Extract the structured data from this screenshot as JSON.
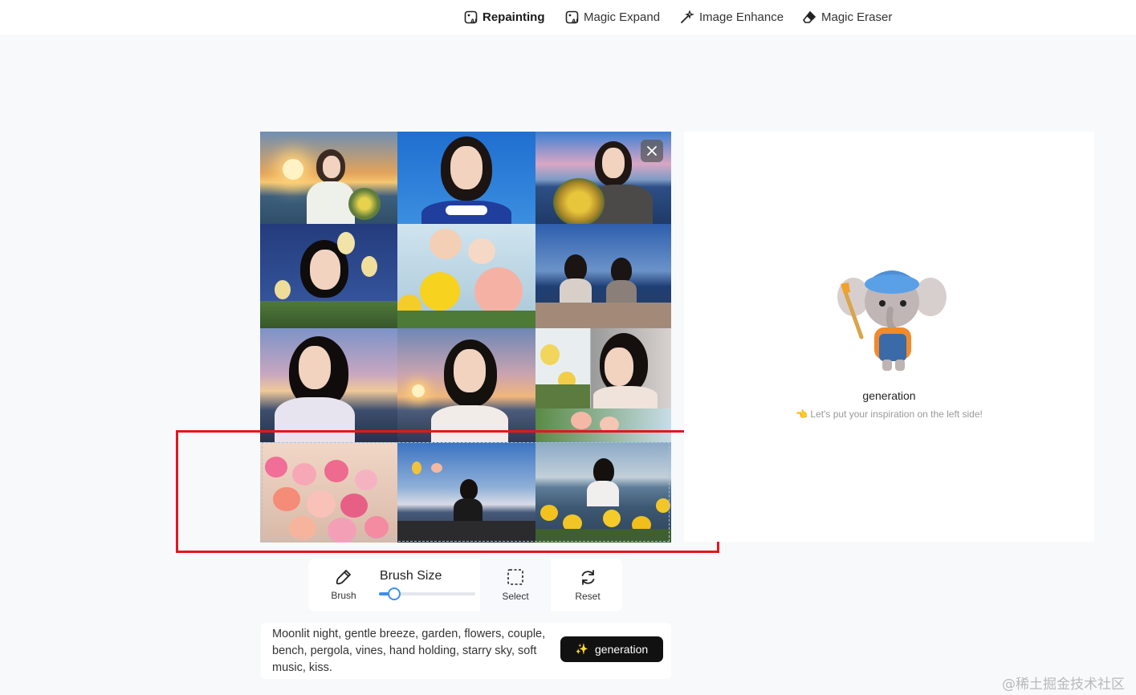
{
  "nav": {
    "items": [
      {
        "label": "Repainting",
        "icon": "ai-image-icon",
        "active": true
      },
      {
        "label": "Magic Expand",
        "icon": "ai-image-icon"
      },
      {
        "label": "Image Enhance",
        "icon": "magic-wand-icon"
      },
      {
        "label": "Magic Eraser",
        "icon": "eraser-icon"
      }
    ]
  },
  "result": {
    "title": "generation",
    "subtitle": "👈 Let's put your inspiration on the left side!"
  },
  "toolbar": {
    "brush_label": "Brush",
    "brush_size_label": "Brush Size",
    "brush_size_value": 0.15,
    "select_label": "Select",
    "reset_label": "Reset"
  },
  "prompt": {
    "text": "Moonlit night, gentle breeze, garden, flowers, couple, bench, pergola, vines, hand holding, starry sky, soft music, kiss.",
    "button_label": "generation"
  },
  "watermark": "@稀土掘金技术社区",
  "colors": {
    "accent_blue": "#3f8ef0",
    "highlight_red": "#e8141c",
    "button_black": "#111111"
  }
}
